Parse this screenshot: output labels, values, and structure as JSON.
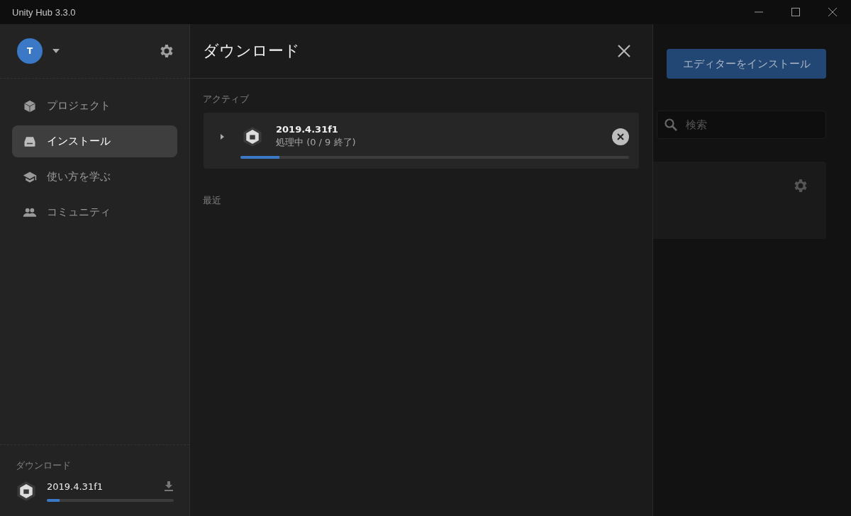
{
  "window": {
    "title": "Unity Hub 3.3.0"
  },
  "account": {
    "initial": "T"
  },
  "sidebar": {
    "items": [
      {
        "label": "プロジェクト",
        "kind": "cube",
        "selected": false
      },
      {
        "label": "インストール",
        "kind": "drive",
        "selected": true
      },
      {
        "label": "使い方を学ぶ",
        "kind": "cap",
        "selected": false
      },
      {
        "label": "コミュニティ",
        "kind": "people",
        "selected": false
      }
    ],
    "downloads": {
      "heading": "ダウンロード",
      "items": [
        {
          "version": "2019.4.31f1",
          "level": 0.1
        }
      ]
    }
  },
  "downloads_panel": {
    "title": "ダウンロード",
    "active_heading": "アクティブ",
    "active": [
      {
        "version": "2019.4.31f1",
        "status": "処理中 (0 / 9 終了)",
        "expanded": false,
        "level": 0.1
      }
    ],
    "recent_heading": "最近"
  },
  "background": {
    "install_button": "エディターをインストール",
    "search": {
      "placeholder": "検索"
    }
  }
}
